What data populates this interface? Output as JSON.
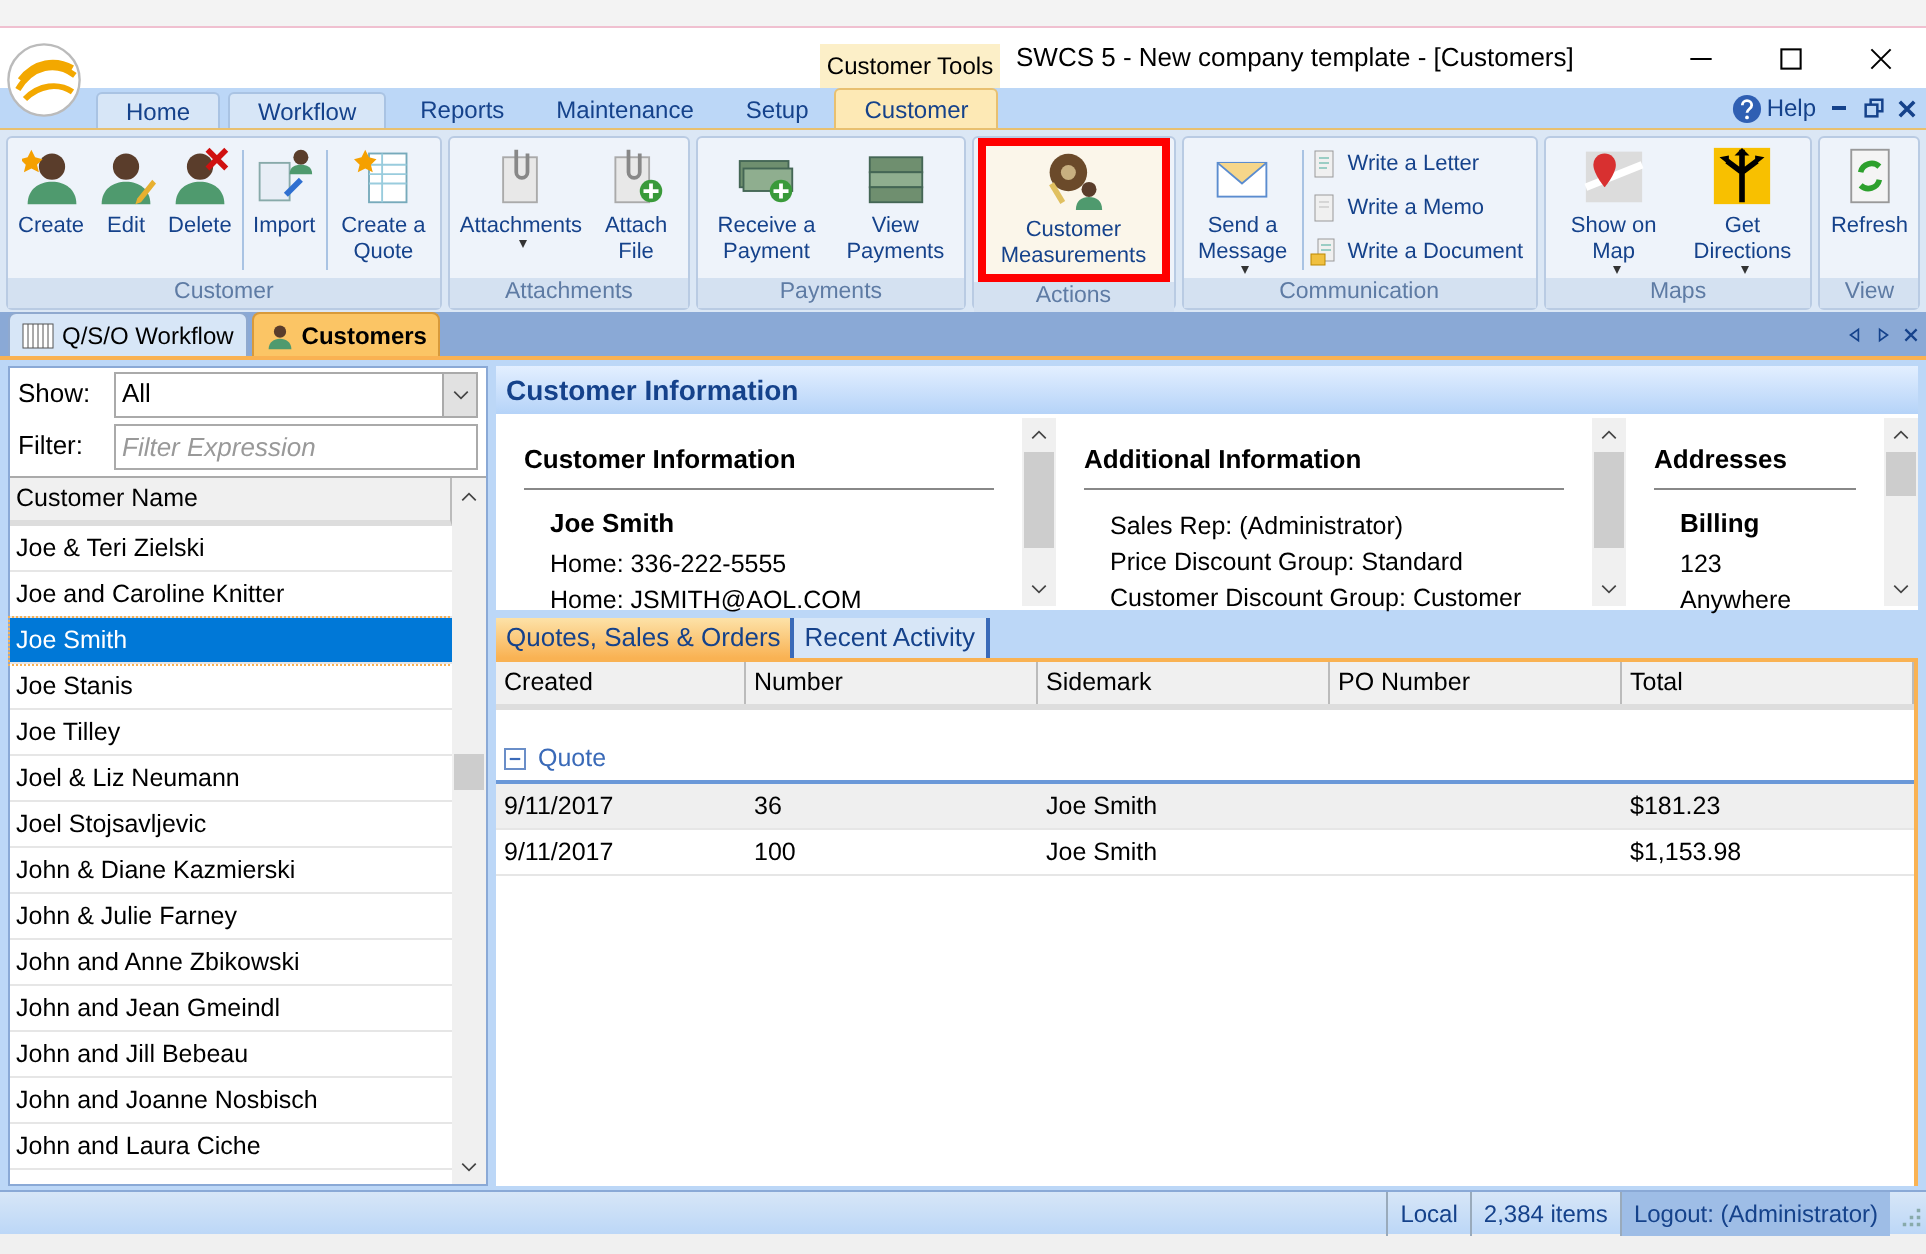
{
  "window": {
    "title": "SWCS 5 - New company template - [Customers]"
  },
  "context_tab": "Customer Tools",
  "ribbon_tabs": [
    {
      "label": "Home",
      "selected": false
    },
    {
      "label": "Workflow",
      "selected": false
    },
    {
      "label": "Reports",
      "selected": false
    },
    {
      "label": "Maintenance",
      "selected": false
    },
    {
      "label": "Setup",
      "selected": false
    },
    {
      "label": "Customer",
      "selected": true
    }
  ],
  "help": "Help",
  "ribbon_groups": [
    {
      "label": "Customer",
      "buttons": [
        {
          "kind": "large",
          "label": "Create",
          "dropdown": false,
          "highlighted": false
        },
        {
          "kind": "large",
          "label": "Edit",
          "dropdown": false,
          "highlighted": false
        },
        {
          "kind": "large",
          "label": "Delete",
          "dropdown": false,
          "highlighted": false
        },
        {
          "kind": "large",
          "label": "Import",
          "dropdown": false,
          "highlighted": false
        },
        {
          "kind": "large",
          "label": "Create a Quote",
          "dropdown": false,
          "highlighted": false
        }
      ]
    },
    {
      "label": "Attachments",
      "buttons": [
        {
          "kind": "large",
          "label": "Attachments",
          "dropdown": true,
          "highlighted": false
        },
        {
          "kind": "large",
          "label": "Attach File",
          "dropdown": false,
          "highlighted": false
        }
      ]
    },
    {
      "label": "Payments",
      "buttons": [
        {
          "kind": "large",
          "label": "Receive a Payment",
          "dropdown": false,
          "highlighted": false
        },
        {
          "kind": "large",
          "label": "View Payments",
          "dropdown": false,
          "highlighted": false
        }
      ]
    },
    {
      "label": "Actions",
      "buttons": [
        {
          "kind": "large",
          "label": "Customer Measurements",
          "dropdown": false,
          "highlighted": true
        }
      ]
    },
    {
      "label": "Communication",
      "buttons": [
        {
          "kind": "large",
          "label": "Send a Message",
          "dropdown": true,
          "highlighted": false
        },
        {
          "kind": "small",
          "label": "Write a Letter",
          "dropdown": false,
          "highlighted": false
        },
        {
          "kind": "small",
          "label": "Write a Memo",
          "dropdown": false,
          "highlighted": false
        },
        {
          "kind": "small",
          "label": "Write a Document",
          "dropdown": false,
          "highlighted": false
        }
      ]
    },
    {
      "label": "Maps",
      "buttons": [
        {
          "kind": "large",
          "label": "Show on Map",
          "dropdown": true,
          "highlighted": false
        },
        {
          "kind": "large",
          "label": "Get Directions",
          "dropdown": true,
          "highlighted": false
        }
      ]
    },
    {
      "label": "View",
      "buttons": [
        {
          "kind": "large",
          "label": "Refresh",
          "dropdown": false,
          "highlighted": false
        }
      ]
    }
  ],
  "doc_tabs": [
    {
      "label": "Q/S/O Workflow",
      "selected": false
    },
    {
      "label": "Customers",
      "selected": true
    }
  ],
  "left_panel": {
    "show_label": "Show:",
    "show_value": "All",
    "filter_label": "Filter:",
    "filter_placeholder": "Filter Expression",
    "column": "Customer Name",
    "rows": [
      {
        "name": "Joe & Teri Zielski",
        "selected": false
      },
      {
        "name": "Joe and Caroline Knitter",
        "selected": false
      },
      {
        "name": "Joe Smith",
        "selected": true
      },
      {
        "name": "Joe Stanis",
        "selected": false
      },
      {
        "name": "Joe Tilley",
        "selected": false
      },
      {
        "name": "Joel & Liz Neumann",
        "selected": false
      },
      {
        "name": "Joel Stojsavljevic",
        "selected": false
      },
      {
        "name": "John & Diane Kazmierski",
        "selected": false
      },
      {
        "name": "John & Julie Farney",
        "selected": false
      },
      {
        "name": "John and Anne Zbikowski",
        "selected": false
      },
      {
        "name": "John and Jean Gmeindl",
        "selected": false
      },
      {
        "name": "John and Jill Bebeau",
        "selected": false
      },
      {
        "name": "John and Joanne Nosbisch",
        "selected": false
      },
      {
        "name": "John and Laura Ciche",
        "selected": false
      }
    ]
  },
  "info": {
    "title": "Customer Information",
    "sections": [
      {
        "title": "Customer Information",
        "heading": "Joe Smith",
        "lines": [
          "Home: 336-222-5555",
          "Home: JSMITH@AOL.COM"
        ]
      },
      {
        "title": "Additional Information",
        "lines": [
          "Sales Rep: (Administrator)",
          "Price Discount Group: Standard",
          "Customer Discount Group: Customer"
        ]
      },
      {
        "title": "Addresses",
        "heading": "Billing",
        "lines": [
          "123",
          "Anywhere"
        ]
      }
    ]
  },
  "bottom_tabs": [
    {
      "label": "Quotes, Sales & Orders",
      "selected": true
    },
    {
      "label": "Recent Activity",
      "selected": false
    }
  ],
  "orders": {
    "columns": [
      "Created",
      "Number",
      "Sidemark",
      "PO Number",
      "Total"
    ],
    "group": {
      "label": "Quote",
      "expanded": true
    },
    "rows": [
      {
        "cells": [
          "9/11/2017",
          "36",
          "Joe Smith",
          "",
          "$181.23"
        ],
        "selected": true
      },
      {
        "cells": [
          "9/11/2017",
          "100",
          "Joe Smith",
          "",
          "$1,153.98"
        ],
        "selected": false
      }
    ]
  },
  "status_bar": [
    "Local",
    "2,384 items",
    "Logout: (Administrator)"
  ]
}
